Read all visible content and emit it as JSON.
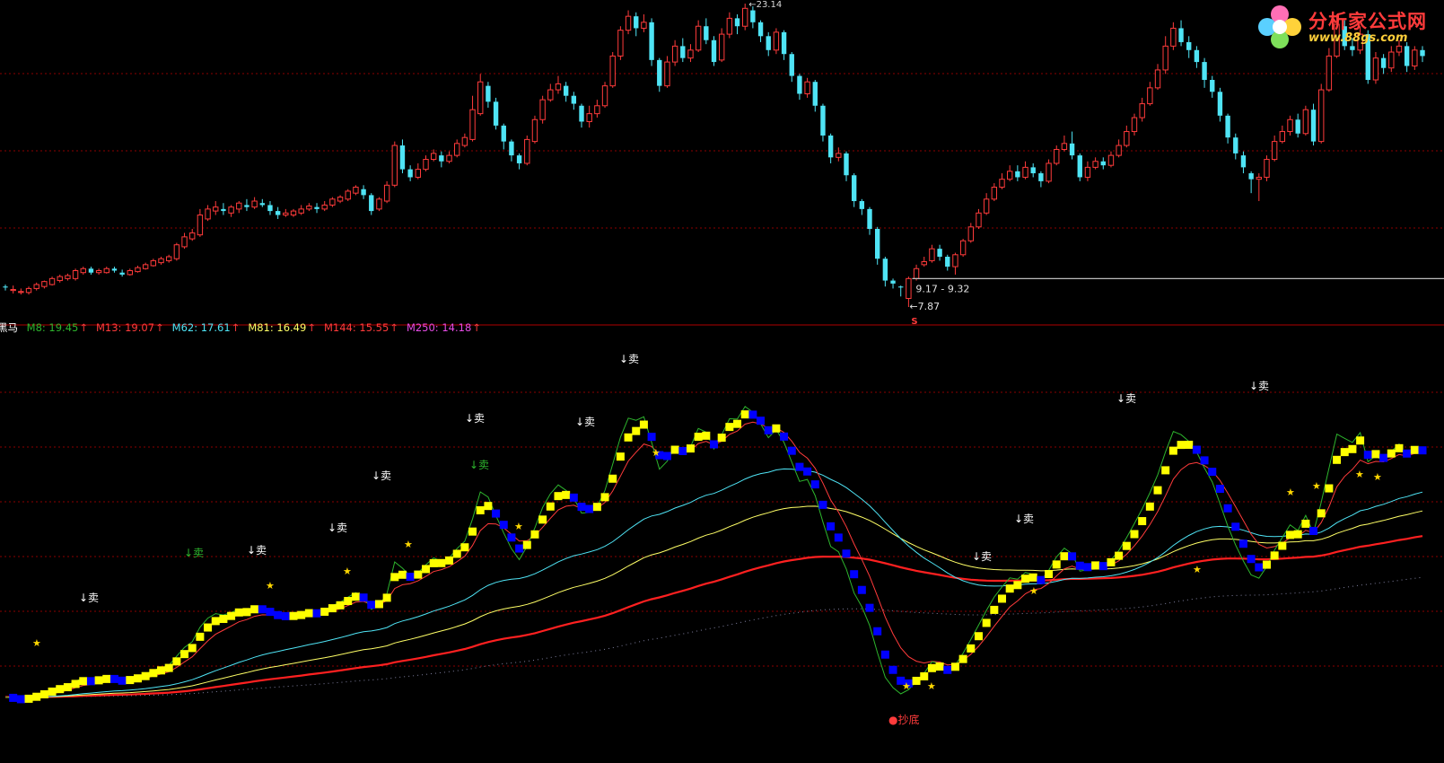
{
  "branding": {
    "title": "分析家公式网",
    "url": "www.88gs.com"
  },
  "colors": {
    "background": "#000000",
    "up_candle": "#ff3b3b",
    "down_candle": "#4fe4f5",
    "yellow_bar": "#ffff00",
    "blue_bar": "#0000ff",
    "grid": "#8b0000",
    "separator": "#b00000"
  },
  "price_panel": {
    "high_label": "23.14",
    "range_label": "9.17 - 9.32",
    "low_label": "7.87",
    "signal_mark": "S"
  },
  "candles": [
    [
      8.9,
      8.85,
      9.0,
      8.7
    ],
    [
      8.7,
      8.75,
      8.95,
      8.55
    ],
    [
      8.6,
      8.65,
      8.8,
      8.5
    ],
    [
      8.6,
      8.8,
      8.9,
      8.5
    ],
    [
      8.8,
      9.0,
      9.1,
      8.7
    ],
    [
      8.9,
      9.15,
      9.2,
      8.8
    ],
    [
      9.0,
      9.3,
      9.4,
      8.95
    ],
    [
      9.2,
      9.4,
      9.5,
      9.1
    ],
    [
      9.3,
      9.45,
      9.55,
      9.2
    ],
    [
      9.3,
      9.7,
      9.8,
      9.2
    ],
    [
      9.6,
      9.8,
      9.9,
      9.5
    ],
    [
      9.8,
      9.6,
      9.9,
      9.5
    ],
    [
      9.6,
      9.7,
      9.8,
      9.5
    ],
    [
      9.6,
      9.8,
      9.9,
      9.55
    ],
    [
      9.8,
      9.7,
      9.9,
      9.6
    ],
    [
      9.6,
      9.5,
      9.75,
      9.4
    ],
    [
      9.5,
      9.7,
      9.8,
      9.45
    ],
    [
      9.65,
      9.85,
      9.95,
      9.6
    ],
    [
      9.8,
      10.0,
      10.1,
      9.75
    ],
    [
      9.95,
      10.2,
      10.3,
      9.9
    ],
    [
      10.1,
      10.3,
      10.4,
      10.0
    ],
    [
      10.2,
      10.4,
      10.5,
      10.1
    ],
    [
      10.3,
      11.0,
      11.1,
      10.2
    ],
    [
      10.9,
      11.4,
      11.6,
      10.8
    ],
    [
      11.3,
      11.6,
      11.8,
      11.2
    ],
    [
      11.5,
      12.5,
      12.8,
      11.4
    ],
    [
      12.3,
      12.8,
      13.0,
      12.2
    ],
    [
      12.7,
      12.9,
      13.2,
      12.5
    ],
    [
      12.8,
      12.7,
      13.1,
      12.5
    ],
    [
      12.6,
      12.9,
      13.0,
      12.4
    ],
    [
      12.8,
      13.1,
      13.2,
      12.6
    ],
    [
      13.0,
      12.9,
      13.3,
      12.7
    ],
    [
      12.9,
      13.2,
      13.4,
      12.8
    ],
    [
      13.1,
      13.0,
      13.3,
      12.9
    ],
    [
      13.0,
      12.7,
      13.2,
      12.5
    ],
    [
      12.7,
      12.5,
      12.9,
      12.3
    ],
    [
      12.5,
      12.6,
      12.8,
      12.4
    ],
    [
      12.5,
      12.7,
      12.8,
      12.4
    ],
    [
      12.6,
      12.8,
      13.0,
      12.5
    ],
    [
      12.8,
      12.95,
      13.1,
      12.7
    ],
    [
      12.9,
      12.8,
      13.1,
      12.6
    ],
    [
      12.8,
      13.0,
      13.2,
      12.7
    ],
    [
      13.0,
      13.3,
      13.4,
      12.9
    ],
    [
      13.2,
      13.4,
      13.5,
      13.1
    ],
    [
      13.3,
      13.7,
      13.8,
      13.2
    ],
    [
      13.6,
      13.9,
      14.0,
      13.5
    ],
    [
      13.8,
      13.5,
      14.0,
      13.3
    ],
    [
      13.5,
      12.7,
      13.6,
      12.5
    ],
    [
      12.8,
      13.3,
      13.4,
      12.7
    ],
    [
      13.2,
      14.0,
      14.2,
      13.1
    ],
    [
      14.0,
      16.0,
      16.2,
      13.9
    ],
    [
      16.0,
      14.8,
      16.3,
      14.6
    ],
    [
      14.8,
      14.4,
      15.0,
      14.2
    ],
    [
      14.4,
      14.8,
      15.1,
      14.3
    ],
    [
      14.8,
      15.3,
      15.5,
      14.7
    ],
    [
      15.3,
      15.6,
      15.8,
      15.2
    ],
    [
      15.5,
      15.2,
      15.7,
      14.9
    ],
    [
      15.2,
      15.5,
      15.7,
      15.1
    ],
    [
      15.5,
      16.1,
      16.3,
      15.4
    ],
    [
      16.0,
      16.4,
      16.6,
      15.9
    ],
    [
      16.3,
      17.8,
      18.5,
      16.2
    ],
    [
      17.6,
      19.2,
      19.6,
      17.5
    ],
    [
      19.0,
      18.2,
      19.2,
      17.9
    ],
    [
      18.2,
      17.0,
      18.4,
      16.8
    ],
    [
      17.0,
      16.2,
      17.1,
      15.8
    ],
    [
      16.2,
      15.5,
      16.3,
      15.2
    ],
    [
      15.5,
      15.1,
      15.6,
      14.8
    ],
    [
      15.1,
      16.3,
      16.5,
      15.0
    ],
    [
      16.2,
      17.3,
      17.5,
      16.1
    ],
    [
      17.3,
      18.3,
      18.5,
      17.1
    ],
    [
      18.3,
      18.8,
      19.1,
      18.2
    ],
    [
      18.8,
      19.1,
      19.5,
      18.6
    ],
    [
      19.0,
      18.5,
      19.2,
      18.2
    ],
    [
      18.5,
      18.1,
      18.7,
      17.8
    ],
    [
      18.0,
      17.2,
      18.1,
      16.9
    ],
    [
      17.2,
      17.6,
      18.0,
      16.9
    ],
    [
      17.6,
      18.0,
      18.3,
      17.4
    ],
    [
      18.0,
      19.0,
      19.2,
      17.9
    ],
    [
      19.0,
      20.5,
      20.7,
      18.9
    ],
    [
      20.5,
      21.8,
      22.0,
      20.3
    ],
    [
      21.8,
      22.5,
      22.8,
      21.6
    ],
    [
      22.5,
      21.9,
      22.7,
      21.5
    ],
    [
      21.9,
      22.2,
      22.6,
      21.7
    ],
    [
      22.2,
      20.3,
      22.4,
      20.0
    ],
    [
      20.3,
      19.0,
      20.4,
      18.7
    ],
    [
      19.0,
      20.2,
      20.5,
      18.9
    ],
    [
      20.2,
      21.0,
      21.3,
      20.0
    ],
    [
      21.0,
      20.4,
      21.4,
      20.2
    ],
    [
      20.4,
      20.8,
      21.1,
      20.2
    ],
    [
      20.8,
      22.0,
      22.3,
      20.7
    ],
    [
      22.0,
      21.3,
      22.4,
      21.1
    ],
    [
      21.3,
      20.2,
      21.5,
      20.0
    ],
    [
      20.3,
      21.6,
      21.9,
      20.2
    ],
    [
      21.6,
      22.4,
      22.7,
      21.4
    ],
    [
      22.4,
      22.0,
      22.6,
      21.6
    ],
    [
      22.0,
      22.9,
      23.14,
      21.8
    ],
    [
      22.8,
      22.2,
      23.0,
      21.9
    ],
    [
      22.2,
      21.5,
      22.3,
      21.2
    ],
    [
      21.5,
      20.8,
      21.7,
      20.5
    ],
    [
      20.8,
      21.7,
      21.9,
      20.6
    ],
    [
      21.7,
      20.6,
      21.8,
      20.3
    ],
    [
      20.6,
      19.5,
      20.7,
      19.2
    ],
    [
      19.5,
      18.6,
      19.6,
      18.3
    ],
    [
      18.6,
      19.2,
      19.4,
      18.4
    ],
    [
      19.2,
      18.0,
      19.3,
      17.7
    ],
    [
      18.0,
      16.5,
      18.1,
      16.2
    ],
    [
      16.5,
      15.4,
      16.6,
      15.1
    ],
    [
      15.4,
      15.6,
      15.9,
      15.2
    ],
    [
      15.6,
      14.5,
      15.7,
      14.2
    ],
    [
      14.5,
      13.2,
      14.6,
      12.9
    ],
    [
      13.2,
      12.8,
      13.3,
      12.5
    ],
    [
      12.8,
      11.8,
      12.9,
      11.5
    ],
    [
      11.8,
      10.3,
      11.9,
      10.0
    ],
    [
      10.3,
      9.2,
      10.4,
      8.9
    ],
    [
      9.2,
      9.05,
      9.3,
      8.8
    ],
    [
      8.9,
      8.85,
      8.95,
      8.4
    ],
    [
      8.3,
      9.3,
      9.4,
      7.87
    ],
    [
      9.3,
      9.8,
      10.0,
      9.2
    ],
    [
      10.0,
      10.15,
      10.4,
      9.9
    ],
    [
      10.2,
      10.8,
      11.0,
      10.1
    ],
    [
      10.8,
      10.4,
      11.0,
      10.2
    ],
    [
      10.4,
      9.9,
      10.5,
      9.7
    ],
    [
      9.9,
      10.5,
      10.6,
      9.5
    ],
    [
      10.5,
      11.2,
      11.3,
      10.4
    ],
    [
      11.2,
      11.9,
      12.1,
      11.1
    ],
    [
      11.9,
      12.6,
      12.8,
      11.8
    ],
    [
      12.6,
      13.3,
      13.6,
      12.5
    ],
    [
      13.3,
      13.9,
      14.1,
      13.2
    ],
    [
      13.9,
      14.3,
      14.6,
      13.8
    ],
    [
      14.3,
      14.7,
      15.0,
      14.2
    ],
    [
      14.7,
      14.4,
      15.0,
      14.2
    ],
    [
      14.4,
      14.9,
      15.2,
      14.3
    ],
    [
      14.9,
      14.6,
      15.1,
      14.4
    ],
    [
      14.6,
      14.2,
      14.7,
      13.9
    ],
    [
      14.2,
      15.1,
      15.3,
      14.1
    ],
    [
      15.1,
      15.8,
      16.0,
      15.0
    ],
    [
      15.8,
      16.1,
      16.5,
      15.7
    ],
    [
      16.1,
      15.5,
      16.7,
      15.3
    ],
    [
      15.5,
      14.4,
      15.6,
      14.2
    ],
    [
      14.4,
      14.9,
      15.2,
      14.2
    ],
    [
      14.9,
      15.2,
      15.4,
      14.8
    ],
    [
      15.2,
      15.0,
      15.4,
      14.8
    ],
    [
      15.0,
      15.5,
      15.7,
      14.9
    ],
    [
      15.5,
      16.0,
      16.3,
      15.4
    ],
    [
      16.0,
      16.7,
      17.0,
      15.9
    ],
    [
      16.7,
      17.4,
      17.6,
      16.5
    ],
    [
      17.4,
      18.1,
      18.4,
      17.2
    ],
    [
      18.1,
      18.9,
      19.2,
      18.0
    ],
    [
      18.9,
      19.8,
      20.1,
      18.8
    ],
    [
      19.8,
      21.0,
      21.5,
      19.6
    ],
    [
      21.0,
      21.9,
      22.2,
      20.8
    ],
    [
      21.9,
      21.2,
      22.3,
      21.0
    ],
    [
      21.2,
      20.8,
      21.5,
      20.4
    ],
    [
      20.8,
      20.2,
      21.0,
      19.9
    ],
    [
      20.2,
      19.3,
      20.4,
      18.9
    ],
    [
      19.3,
      18.7,
      19.5,
      18.4
    ],
    [
      18.7,
      17.5,
      18.9,
      17.2
    ],
    [
      17.5,
      16.4,
      17.6,
      16.1
    ],
    [
      16.4,
      15.6,
      16.6,
      15.3
    ],
    [
      15.5,
      14.9,
      15.7,
      14.6
    ],
    [
      14.6,
      14.3,
      14.7,
      13.6
    ],
    [
      14.3,
      14.4,
      14.6,
      13.2
    ],
    [
      14.4,
      15.3,
      15.5,
      14.2
    ],
    [
      15.3,
      16.2,
      16.5,
      15.2
    ],
    [
      16.2,
      16.7,
      17.0,
      16.1
    ],
    [
      16.7,
      17.3,
      17.5,
      16.5
    ],
    [
      17.3,
      16.6,
      17.6,
      16.4
    ],
    [
      16.6,
      17.8,
      18.0,
      16.5
    ],
    [
      17.8,
      16.2,
      18.1,
      16.0
    ],
    [
      16.2,
      18.8,
      19.1,
      16.1
    ],
    [
      18.8,
      20.5,
      20.9,
      18.7
    ],
    [
      20.5,
      22.1,
      22.6,
      20.4
    ],
    [
      22.0,
      21.0,
      22.3,
      20.8
    ],
    [
      21.0,
      20.8,
      21.4,
      20.5
    ],
    [
      20.8,
      21.6,
      22.0,
      20.6
    ],
    [
      21.6,
      19.3,
      21.8,
      19.1
    ],
    [
      19.3,
      20.4,
      20.7,
      19.1
    ],
    [
      20.4,
      19.9,
      20.6,
      19.6
    ],
    [
      19.9,
      20.7,
      21.0,
      19.7
    ],
    [
      20.7,
      21.0,
      21.3,
      20.5
    ],
    [
      21.0,
      20.0,
      21.2,
      19.7
    ],
    [
      20.0,
      20.8,
      21.0,
      19.8
    ],
    [
      20.8,
      20.5,
      21.0,
      20.2
    ]
  ],
  "indicator": {
    "name": "黑马",
    "items": [
      {
        "label": "M8: 19.45",
        "arrow": "↑",
        "color": "#2db52d"
      },
      {
        "label": "M13: 19.07",
        "arrow": "↑",
        "color": "#ff3b3b"
      },
      {
        "label": "M62: 17.61",
        "arrow": "↑",
        "color": "#4fe4f5"
      },
      {
        "label": "M81: 16.49",
        "arrow": "↑",
        "color": "#ffff66"
      },
      {
        "label": "M144: 15.55",
        "arrow": "↑",
        "color": "#ff3b3b"
      },
      {
        "label": "M250: 14.18",
        "arrow": "↑",
        "color": "#e64ce6"
      }
    ]
  },
  "signals": {
    "sell_text": "↓卖",
    "buy_text": "●抄底",
    "star_text": "★"
  },
  "chart_data": {
    "type": "line",
    "title": "",
    "series": [
      {
        "name": "M8",
        "final": 19.45
      },
      {
        "name": "M13",
        "final": 19.07
      },
      {
        "name": "M62",
        "final": 17.61
      },
      {
        "name": "M81",
        "final": 16.49
      },
      {
        "name": "M144",
        "final": 15.55
      },
      {
        "name": "M250",
        "final": 14.18
      }
    ],
    "price_annotations": {
      "high": 23.14,
      "low": 7.87,
      "range": [
        9.17,
        9.32
      ]
    },
    "grid": true,
    "legend_position": "top-left"
  }
}
